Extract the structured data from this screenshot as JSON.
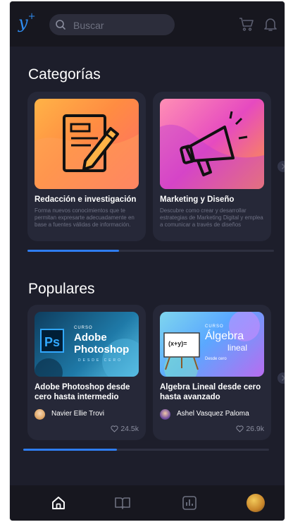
{
  "header": {
    "logo": "y",
    "logo_plus": "+",
    "search_placeholder": "Buscar",
    "cart_icon": "cart-icon",
    "bell_icon": "bell-icon"
  },
  "categories": {
    "title": "Categorías",
    "items": [
      {
        "title": "Redacción e investigación",
        "description": "Forma nuevos conocimientos que te permitan expresarte adecuadamente en base a fuentes válidas de información.",
        "icon": "document-pencil-icon"
      },
      {
        "title": "Marketing y Diseño",
        "description": "Descubre como crear y desarrollar estrategias de Marketing Digital y emplea a comunicar a través de diseños",
        "icon": "megaphone-icon"
      }
    ],
    "scroll_progress": 0.37
  },
  "popular": {
    "title": "Populares",
    "items": [
      {
        "thumb_badge": "CURSO",
        "thumb_logo": "Ps",
        "thumb_title_line1": "Adobe",
        "thumb_title_line2": "Photoshop",
        "thumb_subtitle": "DESDE CERO",
        "title": "Adobe Photoshop desde cero hasta intermedio",
        "author": "Navier Ellie Trovi",
        "likes": "24.5k"
      },
      {
        "thumb_badge": "CURSO",
        "thumb_formula": "(x+y)=",
        "thumb_title_line1": "Álgebra",
        "thumb_title_line2": "lineal",
        "thumb_subtitle": "Desde cero",
        "title": "Algebra Lineal desde cero hasta avanzado",
        "author": "Ashel Vasquez Paloma",
        "likes": "26.9k"
      }
    ],
    "scroll_progress": 0.38
  },
  "nav": {
    "items": [
      "home-icon",
      "book-icon",
      "chart-icon",
      "profile-avatar"
    ],
    "active": "home-icon"
  },
  "colors": {
    "background": "#1d1e2b",
    "card": "#262838",
    "accent": "#2f7df0"
  }
}
